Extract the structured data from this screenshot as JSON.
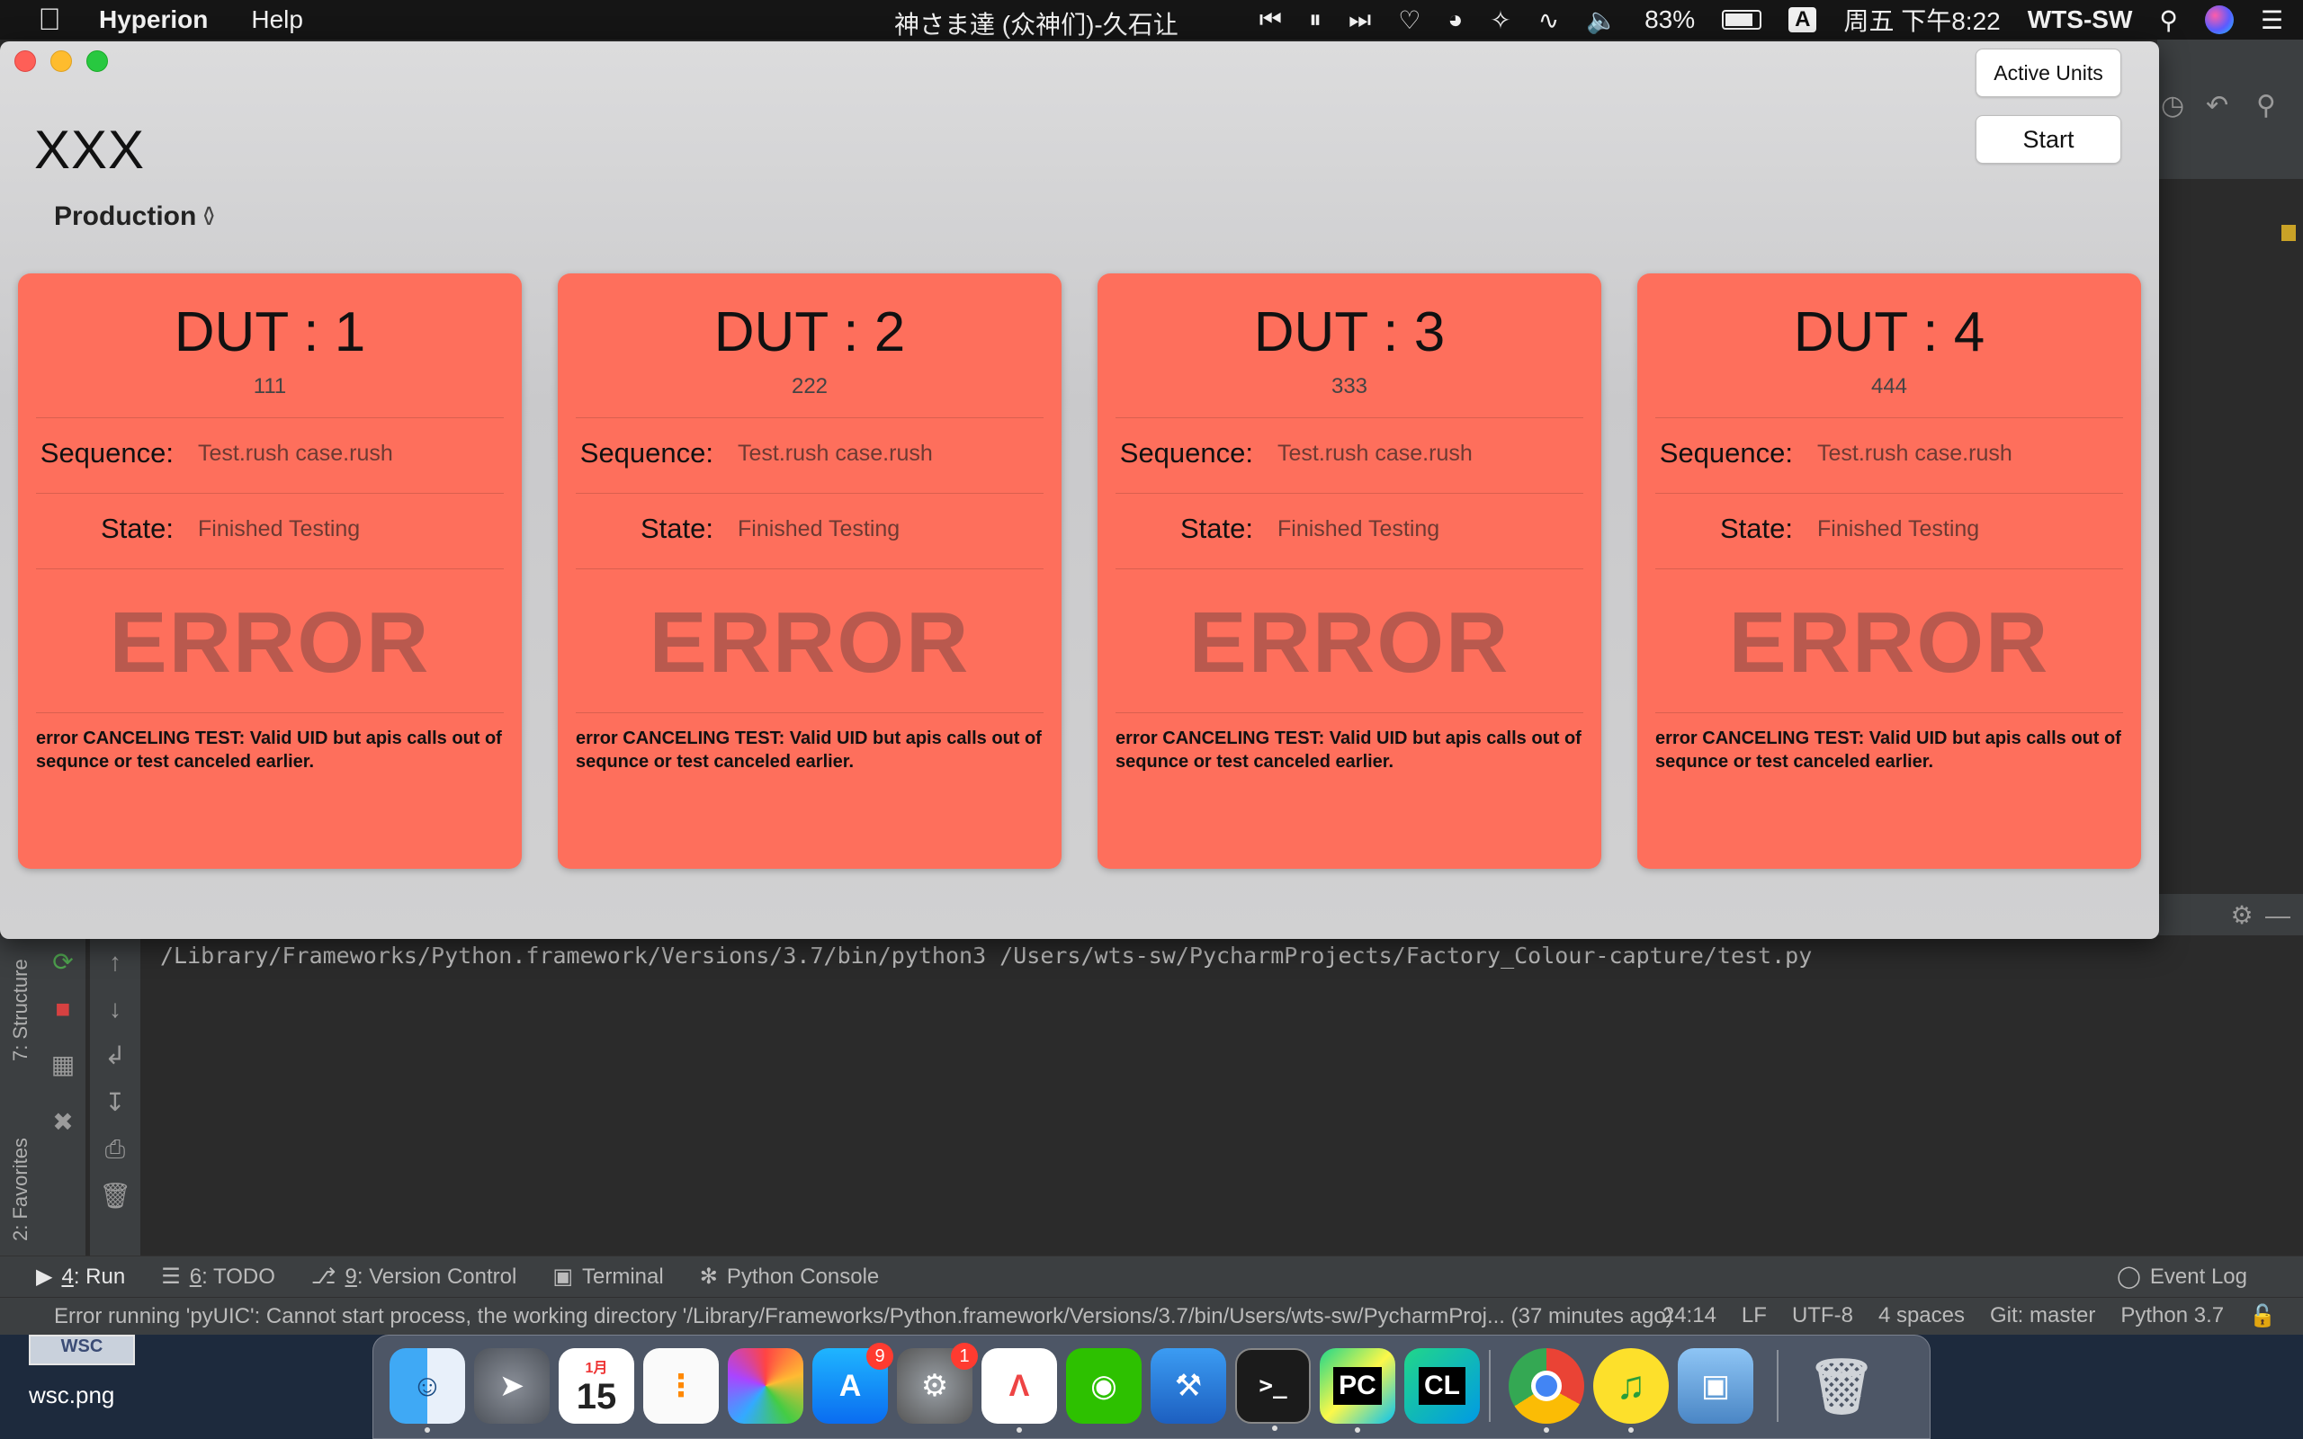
{
  "menubar": {
    "app_name": "Hyperion",
    "menus": [
      "Help"
    ],
    "now_playing": "神さま達 (众神们)-久石让",
    "battery": "83%",
    "ime": "A",
    "clock": "周五 下午8:22",
    "user": "WTS-SW"
  },
  "window": {
    "title": "XXX",
    "mode": "Production",
    "active_units_label": "Active Units",
    "start_label": "Start"
  },
  "field_labels": {
    "sequence": "Sequence:",
    "state": "State:"
  },
  "duts": [
    {
      "title": "DUT : 1",
      "uid": "111",
      "sequence": "Test.rush case.rush",
      "state": "Finished Testing",
      "result": "ERROR",
      "message": "error  CANCELING TEST: Valid UID but apis calls out of sequnce or test canceled earlier."
    },
    {
      "title": "DUT : 2",
      "uid": "222",
      "sequence": "Test.rush case.rush",
      "state": "Finished Testing",
      "result": "ERROR",
      "message": "error  CANCELING TEST: Valid UID but apis calls out of sequnce or test canceled earlier."
    },
    {
      "title": "DUT : 3",
      "uid": "333",
      "sequence": "Test.rush case.rush",
      "state": "Finished Testing",
      "result": "ERROR",
      "message": "error  CANCELING TEST: Valid UID but apis calls out of sequnce or test canceled earlier."
    },
    {
      "title": "DUT : 4",
      "uid": "444",
      "sequence": "Test.rush case.rush",
      "state": "Finished Testing",
      "result": "ERROR",
      "message": "error  CANCELING TEST: Valid UID but apis calls out of sequnce or test canceled earlier."
    }
  ],
  "colors": {
    "card_error": "#fe6f5c",
    "error_text": "#b9594e"
  },
  "ide": {
    "console_line": "/Library/Frameworks/Python.framework/Versions/3.7/bin/python3 /Users/wts-sw/PycharmProjects/Factory_Colour-capture/test.py",
    "side_labels": {
      "structure": "7: Structure",
      "favorites": "2: Favorites"
    },
    "tabs": [
      {
        "num": "4",
        "label": ": Run",
        "icon": "play-icon"
      },
      {
        "num": "6",
        "label": ": TODO",
        "icon": "list-icon"
      },
      {
        "num": "9",
        "label": ": Version Control",
        "icon": "branch-icon"
      },
      {
        "num": "",
        "label": "Terminal",
        "icon": "terminal-icon"
      },
      {
        "num": "",
        "label": "Python Console",
        "icon": "python-icon"
      }
    ],
    "event_log": "Event Log",
    "status_message": "Error running 'pyUIC': Cannot start process, the working directory '/Library/Frameworks/Python.framework/Versions/3.7/bin/Users/wts-sw/PycharmProj... (37 minutes ago)",
    "status": {
      "position": "24:14",
      "line_sep": "LF",
      "encoding": "UTF-8",
      "indent": "4 spaces",
      "git": "Git: master",
      "python": "Python 3.7"
    }
  },
  "desktop": {
    "file_label": "wsc.png",
    "file_thumb_text": "WSC"
  },
  "dock": {
    "calendar_month": "1月",
    "calendar_day": "15",
    "appstore_badge": "9",
    "prefs_badge": "1",
    "icons": [
      "finder-icon",
      "launchpad-icon",
      "calendar-icon",
      "reminders-icon",
      "photos-icon",
      "appstore-icon",
      "system-preferences-icon",
      "creative-app-icon",
      "wechat-icon",
      "xcode-icon",
      "terminal-icon",
      "pycharm-icon",
      "clion-icon",
      "chrome-icon",
      "music-app-icon",
      "preview-icon",
      "trash-icon"
    ],
    "terminal_text": ">_",
    "pycharm_text": "PC",
    "clion_text": "CL"
  }
}
